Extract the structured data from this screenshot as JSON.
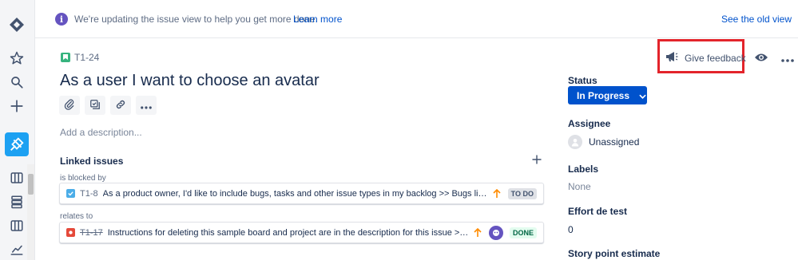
{
  "banner": {
    "message": "We're updating the issue view to help you get more done.",
    "learn_more": "Learn more",
    "see_old_view": "See the old view"
  },
  "issue": {
    "key": "T1-24",
    "title": "As a user I want to choose an avatar",
    "description_placeholder": "Add a description...",
    "give_feedback": "Give feedback"
  },
  "linked_issues": {
    "title": "Linked issues",
    "groups": [
      {
        "relation": "is blocked by",
        "key": "T1-8",
        "summary": "As a product owner, I'd like to include bugs, tasks and other issue types in my backlog >> Bugs like this o...",
        "status": "TO DO",
        "type_color": "#4bade8",
        "priority_color": "#ff8b00"
      },
      {
        "relation": "relates to",
        "key": "T1-17",
        "summary": "Instructions for deleting this sample board and project are in the description for this issue >> Click t...",
        "status": "DONE",
        "type_color": "#e5493a",
        "priority_color": "#ff8b00"
      }
    ]
  },
  "fields": {
    "status_label": "Status",
    "status_value": "In Progress",
    "assignee_label": "Assignee",
    "assignee_value": "Unassigned",
    "labels_label": "Labels",
    "labels_value": "None",
    "effort_label": "Effort de test",
    "effort_value": "0",
    "story_points_label": "Story point estimate"
  },
  "colors": {
    "primary": "#0052cc",
    "highlight_box": "#e3242b",
    "story_icon": "#36b37e"
  }
}
